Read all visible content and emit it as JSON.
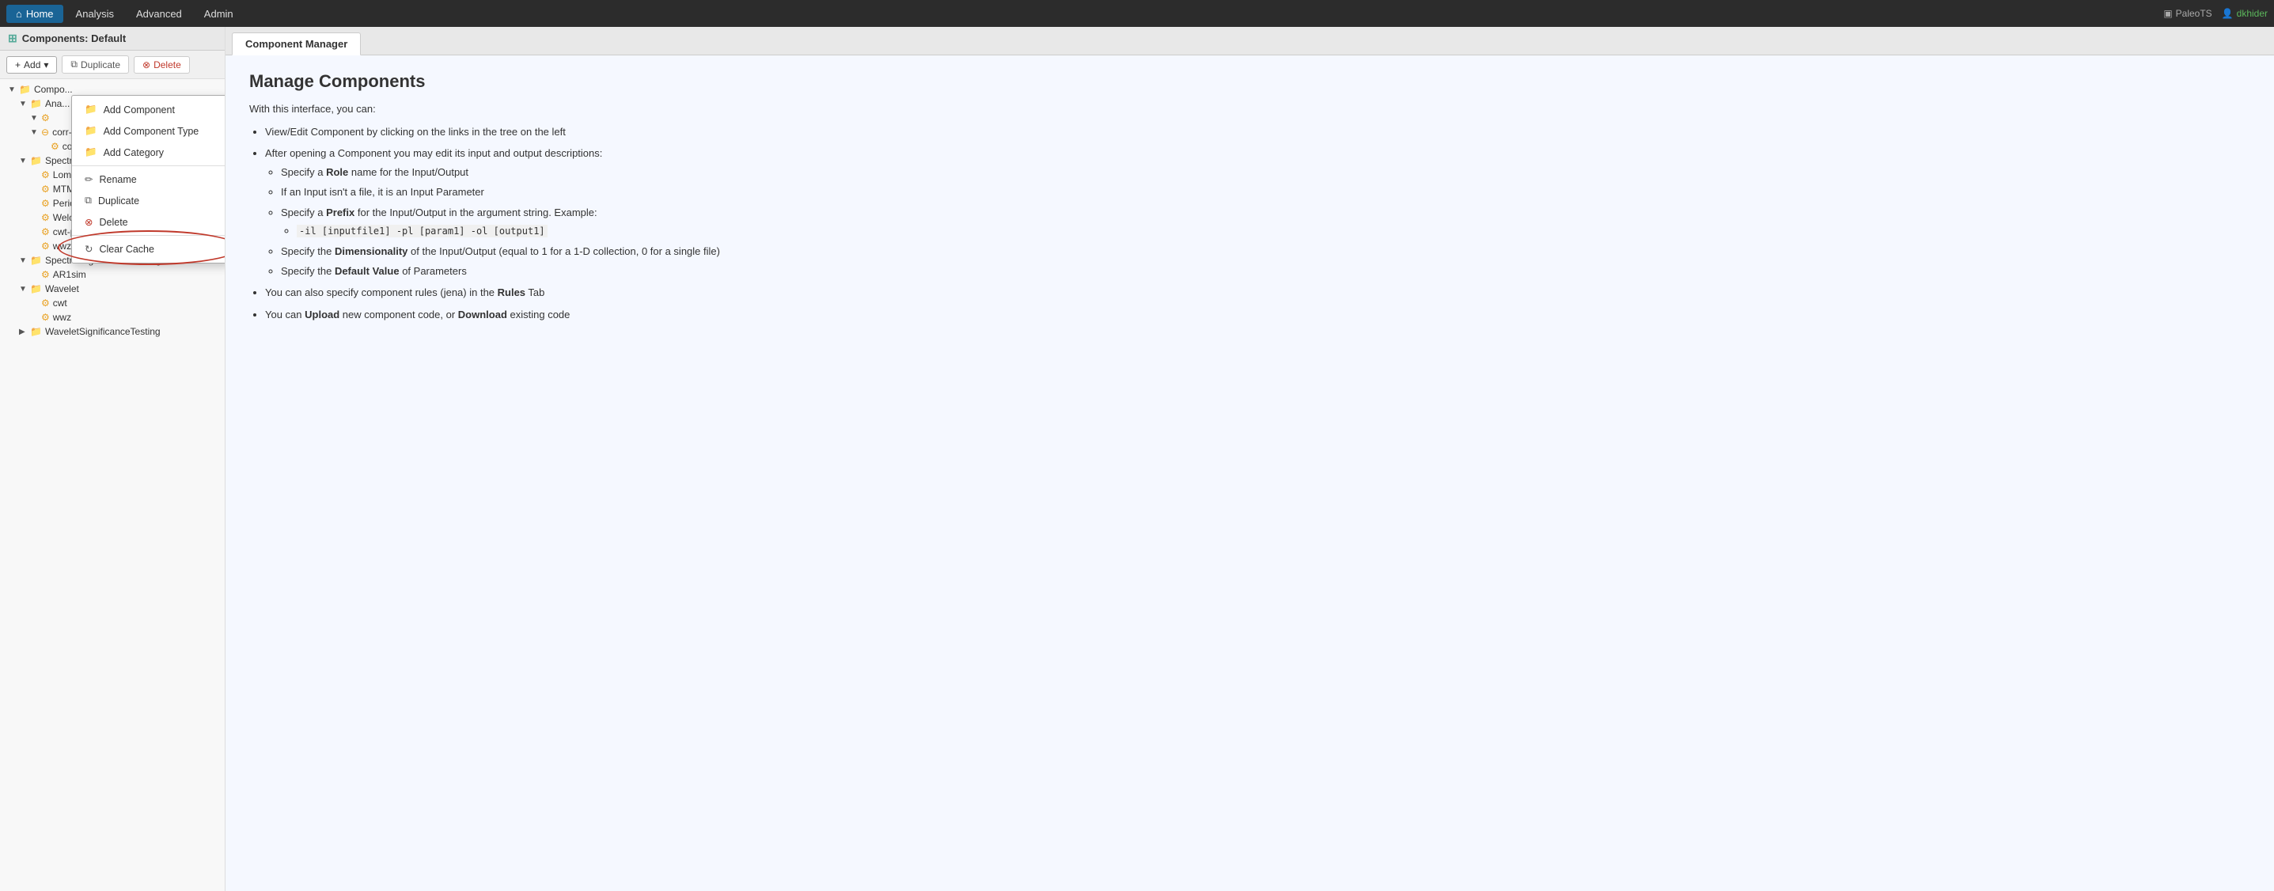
{
  "topNav": {
    "items": [
      {
        "label": "Home",
        "icon": "home",
        "active": true
      },
      {
        "label": "Analysis",
        "active": false
      },
      {
        "label": "Advanced",
        "active": false
      },
      {
        "label": "Admin",
        "active": false
      }
    ],
    "brand": "PaleoTS",
    "user": "dkhider"
  },
  "sidebar": {
    "header": "Components: Default",
    "toolbar": {
      "add_label": "Add",
      "duplicate_label": "Duplicate",
      "delete_label": "Delete"
    },
    "tree": [
      {
        "id": "compo",
        "label": "Compo...",
        "type": "folder",
        "depth": 0,
        "expanded": true
      },
      {
        "id": "ana",
        "label": "Ana...",
        "type": "folder",
        "depth": 1,
        "expanded": true
      },
      {
        "id": "puzzle1",
        "label": "",
        "type": "puzzle",
        "depth": 2,
        "expanded": true
      },
      {
        "id": "spectral",
        "label": "Spectral",
        "type": "folder",
        "depth": 1,
        "expanded": true
      },
      {
        "id": "lombscargle",
        "label": "LombScargle",
        "type": "puzzle",
        "depth": 2
      },
      {
        "id": "mtm",
        "label": "MTM",
        "type": "puzzle",
        "depth": 2
      },
      {
        "id": "periodogram",
        "label": "Periodogram",
        "type": "puzzle",
        "depth": 2
      },
      {
        "id": "welch",
        "label": "Welch",
        "type": "puzzle",
        "depth": 2
      },
      {
        "id": "cwt-psd",
        "label": "cwt-psd",
        "type": "puzzle",
        "depth": 2
      },
      {
        "id": "wwz-psd",
        "label": "wwz-psd",
        "type": "puzzle",
        "depth": 2
      },
      {
        "id": "spectralsigtesting",
        "label": "SpectralSignificanceTesting",
        "type": "folder",
        "depth": 1,
        "expanded": true
      },
      {
        "id": "ar1sim",
        "label": "AR1sim",
        "type": "puzzle",
        "depth": 2
      },
      {
        "id": "wavelet",
        "label": "Wavelet",
        "type": "folder",
        "depth": 1,
        "expanded": true
      },
      {
        "id": "cwt",
        "label": "cwt",
        "type": "puzzle",
        "depth": 2
      },
      {
        "id": "wwz",
        "label": "wwz",
        "type": "puzzle",
        "depth": 2
      },
      {
        "id": "waveletsigtesting",
        "label": "WaveletSignificanceTesting",
        "type": "folder",
        "depth": 1,
        "expanded": false
      }
    ]
  },
  "contextMenu": {
    "items": [
      {
        "label": "Add Component",
        "icon": "folder-add"
      },
      {
        "label": "Add Component Type",
        "icon": "folder-add"
      },
      {
        "label": "Add Category",
        "icon": "folder-add"
      },
      {
        "label": "Rename",
        "icon": "pencil"
      },
      {
        "label": "Duplicate",
        "icon": "copy"
      },
      {
        "label": "Delete",
        "icon": "delete-red"
      },
      {
        "label": "Clear Cache",
        "icon": "refresh",
        "highlighted": true
      }
    ]
  },
  "tabs": [
    {
      "label": "Component Manager",
      "active": true
    }
  ],
  "content": {
    "title": "Manage Components",
    "intro": "With this interface, you can:",
    "bullet1": "View/Edit Component by clicking on the links in the tree on the left",
    "bullet2": "After opening a Component you may edit its input and output descriptions:",
    "sub1": "Specify a ",
    "sub1_bold": "Role",
    "sub1_rest": " name for the Input/Output",
    "sub2": "If an Input isn't a file, it is an Input Parameter",
    "sub3_pre": "Specify a ",
    "sub3_bold": "Prefix",
    "sub3_rest": " for the Input/Output in the argument string. Example:",
    "sub3_code": "-il [inputfile1] -pl [param1] -ol [output1]",
    "sub4_pre": "Specify the ",
    "sub4_bold": "Dimensionality",
    "sub4_rest": " of the Input/Output (equal to 1 for a 1-D collection, 0 for a single file)",
    "sub5_pre": "Specify the ",
    "sub5_bold": "Default Value",
    "sub5_rest": " of Parameters",
    "bullet3_pre": "You can also specify component rules (jena) in the ",
    "bullet3_bold": "Rules",
    "bullet3_rest": " Tab",
    "bullet4_pre": "You can ",
    "bullet4_bold1": "Upload",
    "bullet4_mid": " new component code, or ",
    "bullet4_bold2": "Download",
    "bullet4_rest": " existing code"
  }
}
